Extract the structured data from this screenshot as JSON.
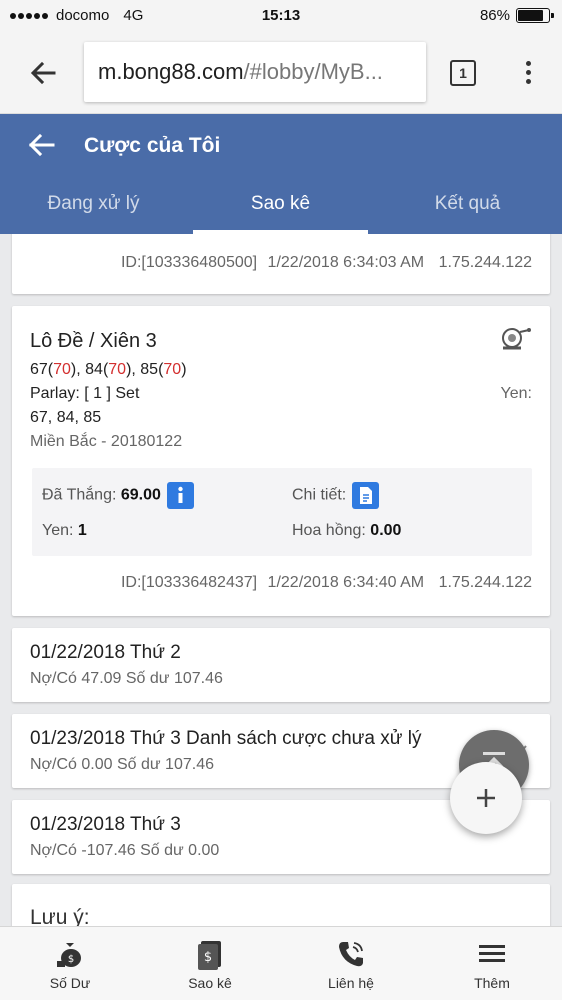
{
  "status_bar": {
    "carrier": "docomo",
    "network": "4G",
    "time": "15:13",
    "battery": "86%",
    "battery_level": 0.86
  },
  "browser": {
    "url_host": "m.bong88.com",
    "url_rest": "/#lobby/MyB...",
    "tab_count": "1"
  },
  "header": {
    "title": "Cược của Tôi",
    "tabs": [
      {
        "label": "Đang xử lý",
        "active": false
      },
      {
        "label": "Sao kê",
        "active": true
      },
      {
        "label": "Kết quả",
        "active": false
      }
    ]
  },
  "prev_card": {
    "meta_id": "ID:[103336480500]",
    "meta_time": "1/22/2018 6:34:03 AM",
    "meta_ip": "1.75.244.122"
  },
  "bet_card": {
    "title": "Lô Đề / Xiên 3",
    "picks": [
      {
        "num": "67",
        "res": "70"
      },
      {
        "num": "84",
        "res": "70"
      },
      {
        "num": "85",
        "res": "70"
      }
    ],
    "parlay": "Parlay: [ 1 ] Set",
    "numbers": "67, 84, 85",
    "region": "Miền Bắc - 20180122",
    "currency_label": "Yen:",
    "won_label": "Đã Thắng:",
    "won_value": "69.00",
    "detail_label": "Chi tiết:",
    "stake_label": "Yen:",
    "stake_value": "1",
    "commission_label": "Hoa hồng:",
    "commission_value": "0.00",
    "meta_id": "ID:[103336482437]",
    "meta_time": "1/22/2018 6:34:40 AM",
    "meta_ip": "1.75.244.122"
  },
  "daily": [
    {
      "date": "01/22/2018 Thứ 2",
      "summary": "Nợ/Có 47.09 Số dư 107.46"
    },
    {
      "date": "01/23/2018 Thứ 3 Danh sách cược chưa xử lý",
      "summary": "Nợ/Có 0.00 Số dư 107.46"
    },
    {
      "date": "01/23/2018 Thứ 3",
      "summary": "Nợ/Có -107.46 Số dư 0.00"
    }
  ],
  "note_title": "Lưu ý:",
  "bottom_nav": [
    {
      "label": "Số Dư",
      "icon": "money-bag-icon"
    },
    {
      "label": "Sao kê",
      "icon": "statement-icon"
    },
    {
      "label": "Liên hệ",
      "icon": "phone-icon"
    },
    {
      "label": "Thêm",
      "icon": "menu-icon"
    }
  ],
  "colors": {
    "header_bg": "#4a6ca8",
    "accent_blue": "#2f7ae0",
    "result_red": "#d32f2f"
  }
}
